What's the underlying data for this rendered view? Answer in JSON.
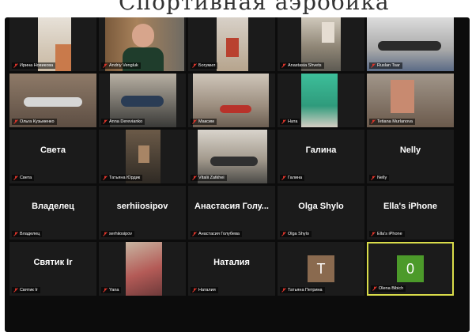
{
  "header_text": "Спортивная аэробика",
  "grid": {
    "tiles": [
      {
        "label": "Ирина Новикова",
        "type": "video"
      },
      {
        "label": "Andriy Vengluk",
        "type": "video"
      },
      {
        "label": "Богумил",
        "type": "video"
      },
      {
        "label": "Anastasia Shvets",
        "type": "video"
      },
      {
        "label": "Ruslan Tsar",
        "type": "video"
      },
      {
        "label": "Ольга Кузьменко",
        "type": "video"
      },
      {
        "label": "Anna Derevianko",
        "type": "video"
      },
      {
        "label": "Максим",
        "type": "video"
      },
      {
        "label": "Ната",
        "type": "video"
      },
      {
        "label": "Tetiana Murlanova",
        "type": "video"
      },
      {
        "label": "Света",
        "display_name": "Света",
        "type": "name"
      },
      {
        "label": "Татьяна Юрдик",
        "type": "video"
      },
      {
        "label": "Vitalii Zatkhei",
        "type": "video"
      },
      {
        "label": "Галина",
        "display_name": "Галина",
        "type": "name"
      },
      {
        "label": "Nelly",
        "display_name": "Nelly",
        "type": "name"
      },
      {
        "label": "Владелец",
        "display_name": "Владелец",
        "type": "name"
      },
      {
        "label": "serhiiosipov",
        "display_name": "serhiiosipov",
        "type": "name"
      },
      {
        "label": "Анастасия Голубева",
        "display_name": "Анастасия Голу...",
        "type": "name"
      },
      {
        "label": "Olga Shylo",
        "display_name": "Olga Shylo",
        "type": "name"
      },
      {
        "label": "Ella's iPhone",
        "display_name": "Ella's iPhone",
        "type": "name"
      },
      {
        "label": "Святик Ir",
        "display_name": "Святик Ir",
        "type": "name"
      },
      {
        "label": "Yana",
        "type": "video"
      },
      {
        "label": "Наталия",
        "display_name": "Наталия",
        "type": "name"
      },
      {
        "label": "Татьяна Петрина",
        "type": "avatar",
        "initial": "T",
        "color": "#8a6a4f"
      },
      {
        "label": "Olena Bibich",
        "type": "avatar",
        "initial": "0",
        "color": "#4c9a2a"
      }
    ]
  },
  "colors": {
    "muted_mic": "#e0352b",
    "active_speaker_border": "#d9dc4a"
  },
  "icons": {
    "muted_mic": "mic-off-icon"
  }
}
